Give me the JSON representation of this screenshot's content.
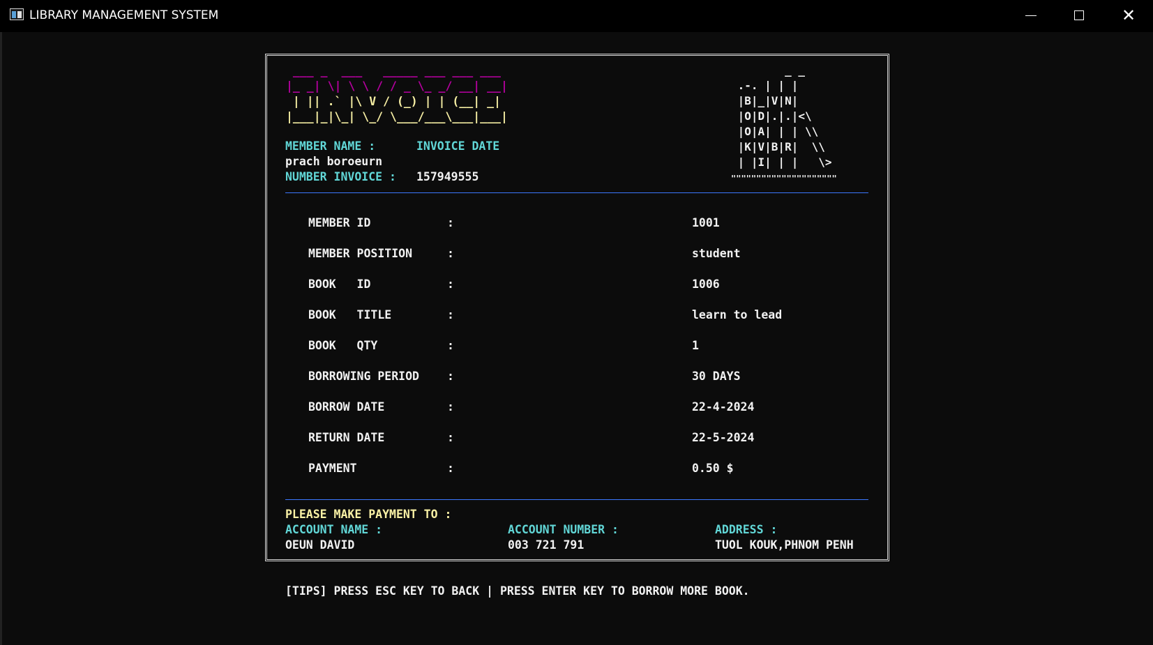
{
  "window": {
    "title": "LIBRARY MANAGEMENT SYSTEM"
  },
  "controls": {
    "minimize": "minimize-icon",
    "maximize": "maximize-icon",
    "close": "✕"
  },
  "invoice": {
    "logo_ascii_lines": [
      " ___ _  ___   _____ ___ ___ ___ ",
      "|_ _| \\| \\ \\ / / _ \\_ _/ __| __|",
      " | || .` |\\ V / (_) | | (__| _| ",
      "|___|_|\\_| \\_/ \\___/___\\___|___|"
    ],
    "book_ascii_lines": [
      "        _ _",
      " .-. | | |",
      " |B|_|V|N|",
      " |O|D|.|.|<\\",
      " |O|A| | | \\\\",
      " |K|V|B|R|  \\\\",
      " | |I| | |   \\>",
      "\"\"\"\"\"\"\"\"\"\"\"\"\"\"\"\"\"\"\"\"\""
    ],
    "member_name_label": "MEMBER NAME :",
    "invoice_date_label": "INVOICE DATE",
    "member_name_value": "prach boroeurn",
    "number_invoice_label": "NUMBER INVOICE :",
    "number_invoice_value": "157949555",
    "rows": [
      {
        "label": "MEMBER ID",
        "value": "1001"
      },
      {
        "label": "MEMBER POSITION",
        "value": "student"
      },
      {
        "label": "BOOK   ID",
        "value": "1006"
      },
      {
        "label": "BOOK   TITLE",
        "value": "learn to lead"
      },
      {
        "label": "BOOK   QTY",
        "value": "1"
      },
      {
        "label": "BORROWING PERIOD",
        "value": "30 DAYS"
      },
      {
        "label": "BORROW DATE",
        "value": "22-4-2024"
      },
      {
        "label": "RETURN DATE",
        "value": "22-5-2024"
      },
      {
        "label": "PAYMENT",
        "value": "0.50 $"
      }
    ],
    "colon": ":",
    "payment_heading": "PLEASE MAKE PAYMENT TO :",
    "account_name_label": "ACCOUNT NAME :",
    "account_name_value": "OEUN DAVID",
    "account_number_label": "ACCOUNT NUMBER :",
    "account_number_value": "003 721 791",
    "address_label": "ADDRESS :",
    "address_value": "TUOL KOUK,PHNOM PENH"
  },
  "tips": "[TIPS] PRESS ESC KEY TO BACK | PRESS ENTER KEY TO BORROW MORE BOOK.",
  "colors": {
    "background": "#0c0c0c",
    "cyan": "#61d6d6",
    "yellow": "#f9f1a5",
    "magenta": "#b4009e",
    "divider": "#3b78ff"
  }
}
